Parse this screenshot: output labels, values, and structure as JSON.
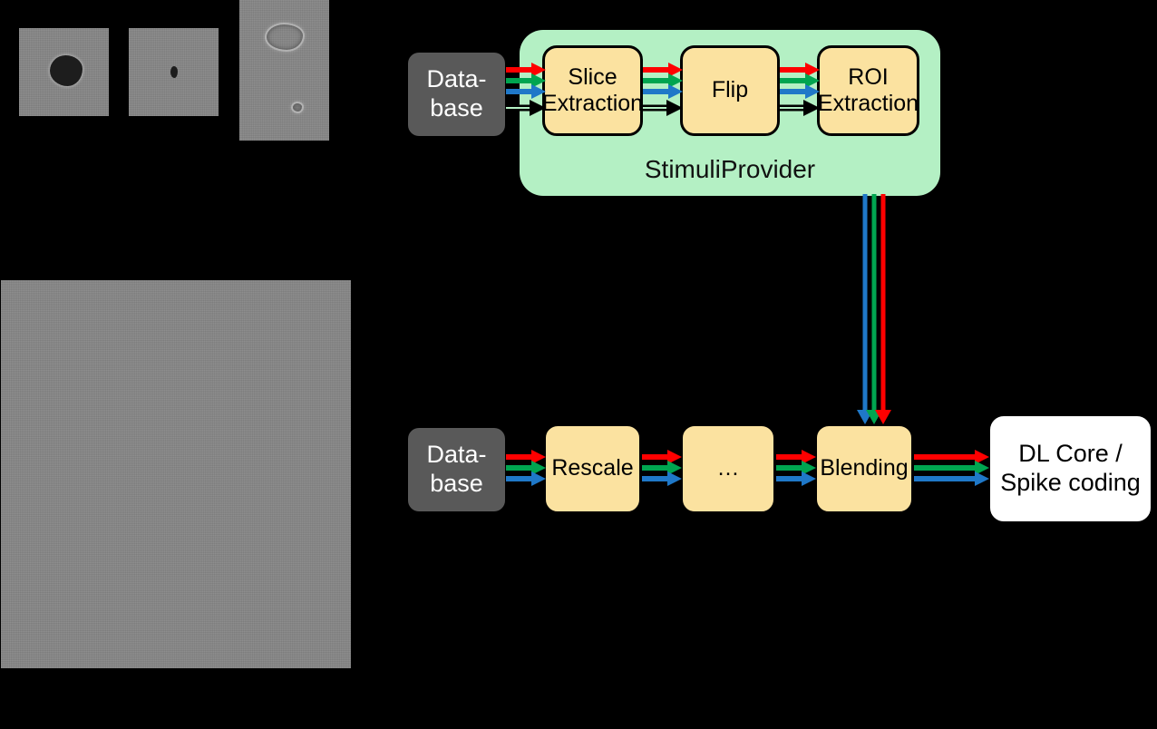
{
  "figure": {
    "title": "StimuliProvider data pipeline",
    "background_color": "#000000"
  },
  "palette": {
    "database_fill": "#595959",
    "database_text": "#FFFFFF",
    "process_fill": "#FBE2A0",
    "process_border": "#000000",
    "group_fill": "#B4F0C4",
    "output_fill": "#FFFFFF",
    "channel_red": "#FF0000",
    "channel_green": "#00A550",
    "channel_blue": "#1F78C8",
    "aux_line": "#000000"
  },
  "samples": [
    {
      "label": "sample-thumbnail-1",
      "note": "grayscale patch with dark star-shaped blob"
    },
    {
      "label": "sample-thumbnail-2",
      "note": "grayscale patch with small dark speck"
    },
    {
      "label": "sample-thumbnail-3",
      "note": "tall grayscale patch with two faint outlines"
    },
    {
      "label": "sample-large-background",
      "note": "large flat grayscale noise field"
    }
  ],
  "group": {
    "name": "StimuliProvider",
    "label": "StimuliProvider"
  },
  "top_row": {
    "database": {
      "label": "Data-\nbase"
    },
    "stages": [
      {
        "id": "slice-extraction",
        "label": "Slice\nExtraction"
      },
      {
        "id": "flip",
        "label": "Flip"
      },
      {
        "id": "roi-extraction",
        "label": "ROI\nExtraction"
      }
    ]
  },
  "bottom_row": {
    "database": {
      "label": "Data-\nbase"
    },
    "stages": [
      {
        "id": "rescale",
        "label": "Rescale"
      },
      {
        "id": "ellipsis",
        "label": "…"
      },
      {
        "id": "blending",
        "label": "Blending"
      }
    ],
    "output": {
      "id": "dl-core",
      "label": "DL Core /\nSpike coding"
    }
  },
  "channels": {
    "names": [
      "red",
      "green",
      "blue"
    ],
    "colors": [
      "#FF0000",
      "#00A550",
      "#1F78C8"
    ],
    "auxiliary": {
      "name": "labels-path",
      "style": "double-line-black-arrow"
    }
  },
  "flows": [
    {
      "from": "Data-base (top)",
      "to": "Slice Extraction",
      "channels": [
        "red",
        "green",
        "blue"
      ],
      "aux": true
    },
    {
      "from": "Slice Extraction",
      "to": "Flip",
      "channels": [
        "red",
        "green",
        "blue"
      ],
      "aux": true
    },
    {
      "from": "Flip",
      "to": "ROI Extraction",
      "channels": [
        "red",
        "green",
        "blue"
      ],
      "aux": true
    },
    {
      "from": "StimuliProvider",
      "to": "Blending",
      "channels": [
        "blue",
        "green",
        "red"
      ],
      "aux": false,
      "orientation": "vertical"
    },
    {
      "from": "Data-base (bottom)",
      "to": "Rescale",
      "channels": [
        "red",
        "green",
        "blue"
      ],
      "aux": false
    },
    {
      "from": "Rescale",
      "to": "…",
      "channels": [
        "red",
        "green",
        "blue"
      ],
      "aux": false
    },
    {
      "from": "…",
      "to": "Blending",
      "channels": [
        "red",
        "green",
        "blue"
      ],
      "aux": false
    },
    {
      "from": "Blending",
      "to": "DL Core / Spike coding",
      "channels": [
        "red",
        "green",
        "blue"
      ],
      "aux": false
    }
  ]
}
